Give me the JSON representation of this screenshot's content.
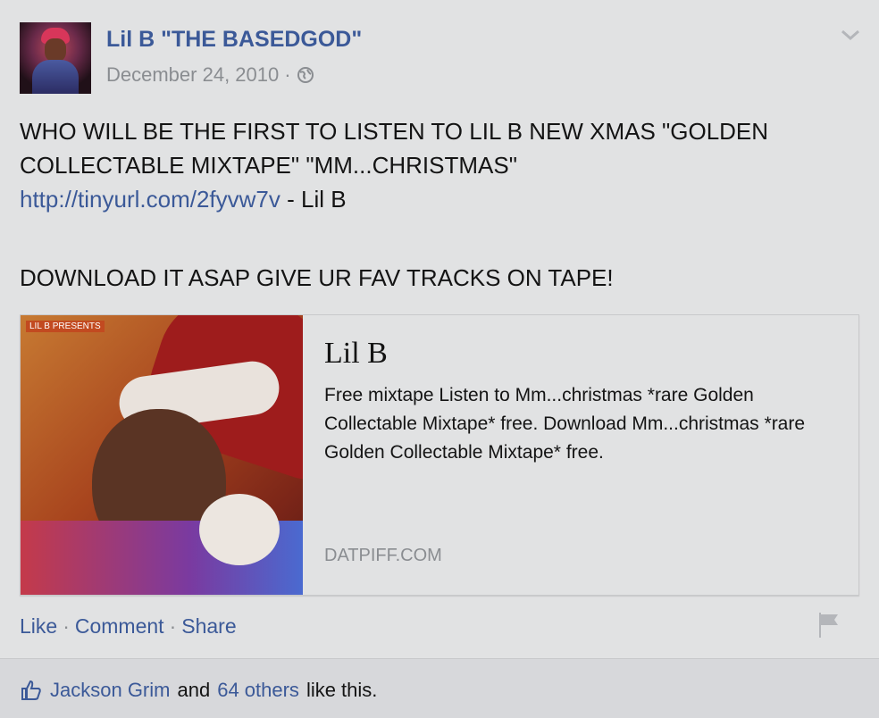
{
  "post": {
    "author": "Lil B \"THE BASEDGOD\"",
    "date": "December 24, 2010",
    "separator": "·",
    "privacy_icon": "globe-icon",
    "menu_icon": "chevron-down-icon",
    "text_lines": [
      "WHO WILL BE THE FIRST TO LISTEN TO LIL B NEW XMAS \"GOLDEN",
      "COLLECTABLE MIXTAPE\" \"MM...CHRISTMAS\""
    ],
    "link_text": "http://tinyurl.com/2fyvw7v",
    "link_suffix": " - Lil B",
    "text_line_after": "DOWNLOAD IT ASAP GIVE UR FAV TRACKS ON TAPE!"
  },
  "card": {
    "image_label": "LIL B PRESENTS",
    "title": "Lil B",
    "description": "Free mixtape Listen to Mm...christmas *rare Golden Collectable Mixtape* free. Download Mm...christmas *rare Golden Collectable Mixtape* free.",
    "domain": "DATPIFF.COM"
  },
  "actions": {
    "like": "Like",
    "comment": "Comment",
    "share": "Share",
    "dot": "·",
    "flag_icon": "flag-icon"
  },
  "likes": {
    "icon": "thumbs-up-icon",
    "first_name": "Jackson Grim",
    "and": "and",
    "others": "64 others",
    "suffix": "like this."
  },
  "colors": {
    "link": "#3b5998",
    "muted": "#8a8d91",
    "background": "#e1e2e3"
  }
}
